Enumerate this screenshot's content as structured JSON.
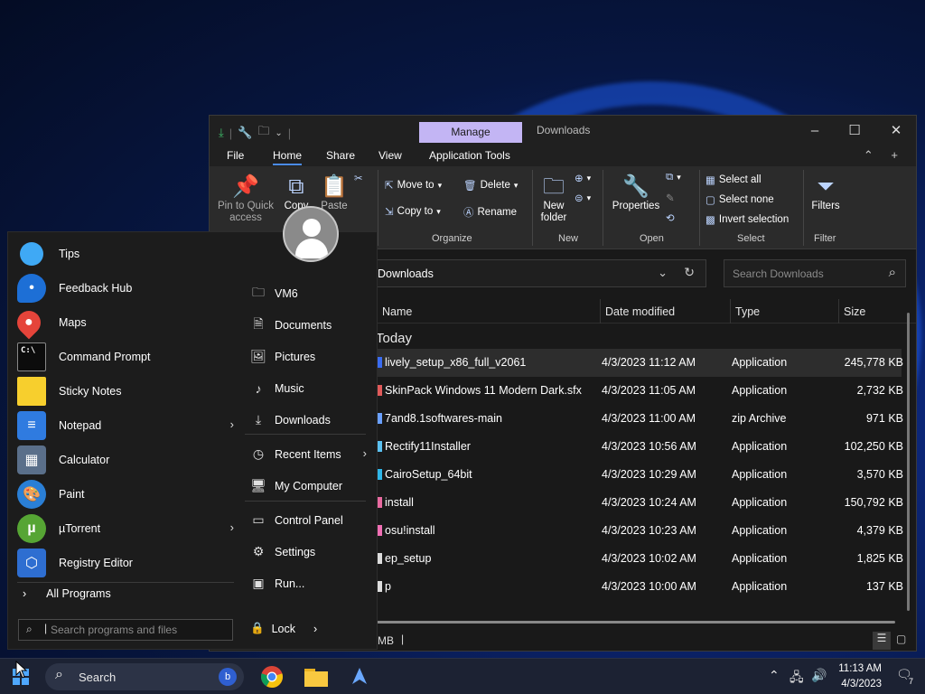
{
  "explorer": {
    "title": "Downloads",
    "manage_tab": "Manage",
    "menu": {
      "file": "File",
      "home": "Home",
      "share": "Share",
      "view": "View",
      "app_tools": "Application Tools"
    },
    "ribbon": {
      "pin": "Pin to Quick access",
      "copy": "Copy",
      "paste": "Paste",
      "move_to": "Move to",
      "copy_to": "Copy to",
      "delete": "Delete",
      "rename": "Rename",
      "new_folder": "New folder",
      "properties": "Properties",
      "select_all": "Select all",
      "select_none": "Select none",
      "invert_selection": "Invert selection",
      "filters": "Filters",
      "groups": {
        "organize": "Organize",
        "new": "New",
        "open": "Open",
        "select": "Select",
        "filter": "Filter"
      }
    },
    "address": "Downloads",
    "search_placeholder": "Search Downloads",
    "columns": {
      "name": "Name",
      "date": "Date modified",
      "type": "Type",
      "size": "Size"
    },
    "group": "Today",
    "files": [
      {
        "name": "lively_setup_x86_full_v2061",
        "date": "4/3/2023 11:12 AM",
        "type": "Application",
        "size": "245,778 KB",
        "color": "#3a6cf0"
      },
      {
        "name": "SkinPack Windows 11 Modern Dark.sfx",
        "date": "4/3/2023 11:05 AM",
        "type": "Application",
        "size": "2,732 KB",
        "color": "#e05a5a"
      },
      {
        "name": "7and8.1softwares-main",
        "date": "4/3/2023 11:00 AM",
        "type": "zip Archive",
        "size": "971 KB",
        "color": "#6aa0ff"
      },
      {
        "name": "Rectify11Installer",
        "date": "4/3/2023 10:56 AM",
        "type": "Application",
        "size": "102,250 KB",
        "color": "#5bc0f0"
      },
      {
        "name": "CairoSetup_64bit",
        "date": "4/3/2023 10:29 AM",
        "type": "Application",
        "size": "3,570 KB",
        "color": "#2fb6e8"
      },
      {
        "name": "install",
        "date": "4/3/2023 10:24 AM",
        "type": "Application",
        "size": "150,792 KB",
        "color": "#e86aa0"
      },
      {
        "name": "osu!install",
        "date": "4/3/2023 10:23 AM",
        "type": "Application",
        "size": "4,379 KB",
        "color": "#f06fb4"
      },
      {
        "name": "ep_setup",
        "date": "4/3/2023 10:02 AM",
        "type": "Application",
        "size": "1,825 KB",
        "color": "#dcdcdc"
      },
      {
        "name": "p",
        "date": "4/3/2023 10:00 AM",
        "type": "Application",
        "size": "137 KB",
        "color": "#dcdcdc"
      }
    ],
    "status_size": "MB"
  },
  "start_menu": {
    "apps": [
      {
        "label": "Tips",
        "icon": "lightbulb-icon",
        "color": "#3fa9f5"
      },
      {
        "label": "Feedback Hub",
        "icon": "feedback-icon",
        "color": "#1d6fd6"
      },
      {
        "label": "Maps",
        "icon": "map-pin-icon",
        "color": "#e5443a"
      },
      {
        "label": "Command Prompt",
        "icon": "terminal-icon",
        "color": "#0c0c0c"
      },
      {
        "label": "Sticky Notes",
        "icon": "sticky-note-icon",
        "color": "#f7cf2d"
      },
      {
        "label": "Notepad",
        "icon": "notepad-icon",
        "color": "#2f7be0"
      },
      {
        "label": "Calculator",
        "icon": "calculator-icon",
        "color": "#5a6f8a"
      },
      {
        "label": "Paint",
        "icon": "palette-icon",
        "color": "#2a7fd6"
      },
      {
        "label": "µTorrent",
        "icon": "utorrent-icon",
        "color": "#56a534"
      },
      {
        "label": "Registry Editor",
        "icon": "registry-icon",
        "color": "#2e6ed1"
      }
    ],
    "all_programs": "All Programs",
    "places": [
      {
        "label": "VM6",
        "icon": "user-folder-icon"
      },
      {
        "label": "Documents",
        "icon": "document-icon"
      },
      {
        "label": "Pictures",
        "icon": "picture-icon"
      },
      {
        "label": "Music",
        "icon": "music-icon"
      },
      {
        "label": "Downloads",
        "icon": "download-icon"
      },
      {
        "label": "Recent Items",
        "icon": "clock-icon"
      },
      {
        "label": "My Computer",
        "icon": "computer-icon"
      },
      {
        "label": "Control Panel",
        "icon": "control-panel-icon"
      },
      {
        "label": "Settings",
        "icon": "gear-icon"
      },
      {
        "label": "Run...",
        "icon": "run-icon"
      }
    ],
    "search_placeholder": "Search programs and files",
    "lock": "Lock"
  },
  "taskbar": {
    "search_label": "Search",
    "time": "11:13 AM",
    "date": "4/3/2023",
    "notifications": "7"
  }
}
